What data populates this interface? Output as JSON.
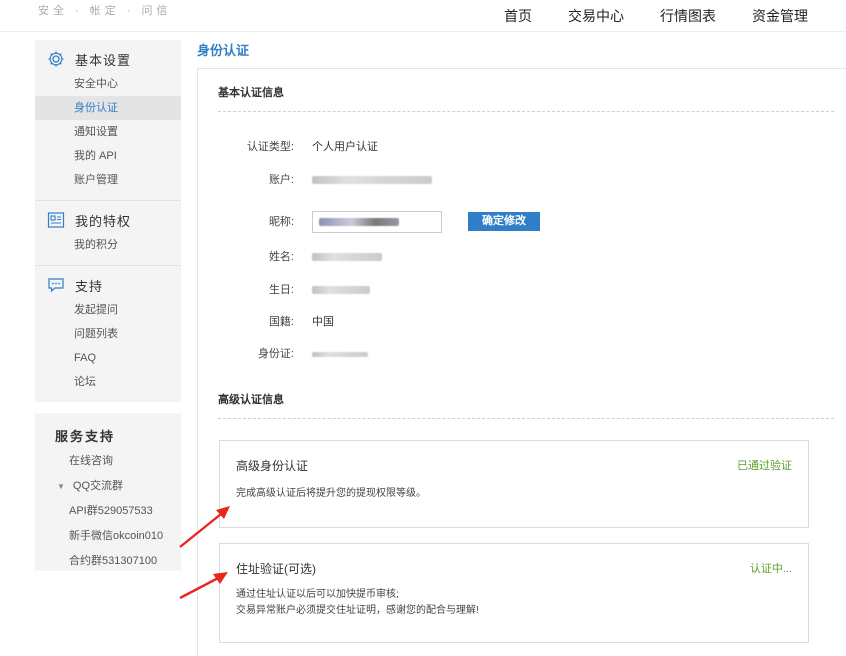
{
  "topbar": {
    "faded_text": "安全 · 帐定 · 问信",
    "nav": [
      "首页",
      "交易中心",
      "行情图表",
      "资金管理"
    ]
  },
  "sidebar": {
    "groups": [
      {
        "title": "基本设置",
        "icon": "gear-icon",
        "items": [
          "安全中心",
          "身份认证",
          "通知设置",
          "我的 API",
          "账户管理"
        ]
      },
      {
        "title": "我的特权",
        "icon": "privilege-icon",
        "items": [
          "我的积分"
        ]
      },
      {
        "title": "支持",
        "icon": "chat-icon",
        "items": [
          "发起提问",
          "问题列表",
          "FAQ",
          "论坛"
        ]
      }
    ],
    "active_item": "身份认证"
  },
  "service": {
    "title": "服务支持",
    "items": [
      "在线咨询",
      "QQ交流群",
      "API群529057533",
      "新手微信okcoin010",
      "合约群531307100"
    ]
  },
  "page": {
    "title": "身份认证",
    "basic_title": "基本认证信息",
    "fields": {
      "type_label": "认证类型:",
      "type_value": "个人用户认证",
      "account_label": "账户:",
      "nickname_label": "昵称:",
      "name_label": "姓名:",
      "birthday_label": "生日:",
      "nationality_label": "国籍:",
      "nationality_value": "中国",
      "idcard_label": "身份证:"
    },
    "confirm_button": "确定修改",
    "advanced_title": "高级认证信息",
    "cards": [
      {
        "title": "高级身份认证",
        "status": "已通过验证",
        "desc": "完成高级认证后将提升您的提现权限等级。"
      },
      {
        "title": "住址验证(可选)",
        "status": "认证中...",
        "desc1": "通过住址认证以后可以加快提币审核;",
        "desc2": "交易异常账户必须提交住址证明，感谢您的配合与理解!"
      }
    ]
  },
  "colors": {
    "accent": "#2f7ec7",
    "success": "#5aa02c",
    "arrow": "#e8271f"
  }
}
